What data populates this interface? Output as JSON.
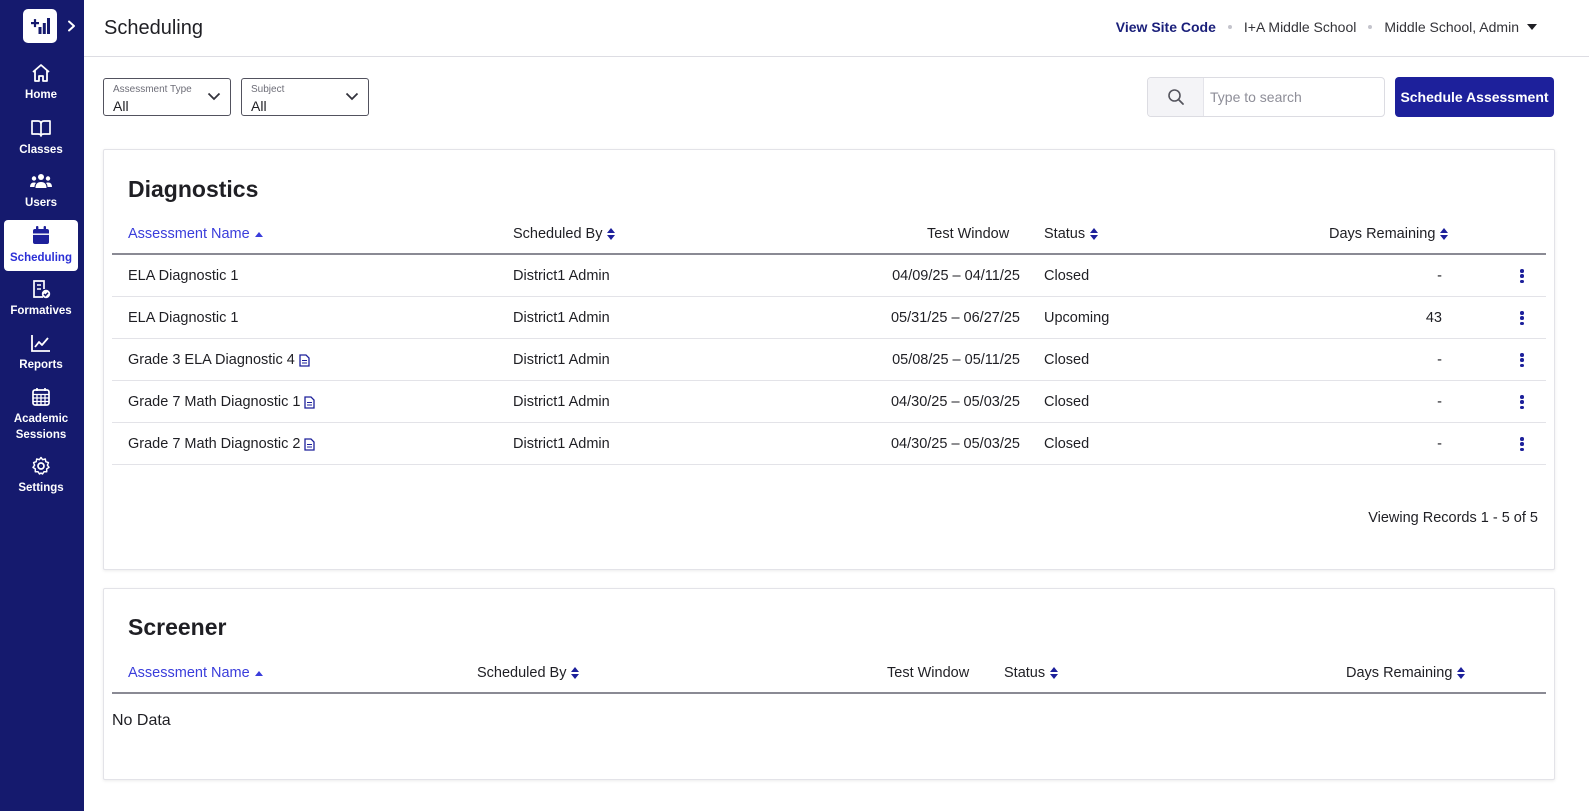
{
  "sidebar": {
    "items": [
      {
        "label": "Home",
        "icon": "home-icon"
      },
      {
        "label": "Classes",
        "icon": "book-icon"
      },
      {
        "label": "Users",
        "icon": "users-icon"
      },
      {
        "label": "Scheduling",
        "icon": "calendar-icon",
        "active": true
      },
      {
        "label": "Formatives",
        "icon": "formatives-icon"
      },
      {
        "label": "Reports",
        "icon": "chart-icon"
      },
      {
        "label": "Academic Sessions",
        "icon": "grid-calendar-icon"
      },
      {
        "label": "Settings",
        "icon": "gear-icon"
      }
    ]
  },
  "header": {
    "title": "Scheduling",
    "site_code_link": "View Site Code",
    "school": "I+A Middle School",
    "user": "Middle School, Admin"
  },
  "filters": {
    "assessment_type": {
      "label": "Assessment Type",
      "value": "All"
    },
    "subject": {
      "label": "Subject",
      "value": "All"
    }
  },
  "search": {
    "placeholder": "Type to search"
  },
  "actions": {
    "schedule_label": "Schedule Assessment"
  },
  "diagnostics": {
    "title": "Diagnostics",
    "columns": {
      "name": "Assessment Name",
      "scheduled_by": "Scheduled By",
      "test_window": "Test Window",
      "status": "Status",
      "days_remaining": "Days Remaining"
    },
    "rows": [
      {
        "name": "ELA Diagnostic 1",
        "doc": false,
        "scheduled_by": "District1 Admin",
        "window": "04/09/25 – 04/11/25",
        "status": "Closed",
        "days": "-"
      },
      {
        "name": "ELA Diagnostic 1",
        "doc": false,
        "scheduled_by": "District1 Admin",
        "window": "05/31/25 – 06/27/25",
        "status": "Upcoming",
        "days": "43"
      },
      {
        "name": "Grade 3 ELA Diagnostic 4",
        "doc": true,
        "scheduled_by": "District1 Admin",
        "window": "05/08/25 – 05/11/25",
        "status": "Closed",
        "days": "-"
      },
      {
        "name": "Grade 7 Math Diagnostic 1",
        "doc": true,
        "scheduled_by": "District1 Admin",
        "window": "04/30/25 – 05/03/25",
        "status": "Closed",
        "days": "-"
      },
      {
        "name": "Grade 7 Math Diagnostic 2",
        "doc": true,
        "scheduled_by": "District1 Admin",
        "window": "04/30/25 – 05/03/25",
        "status": "Closed",
        "days": "-"
      }
    ],
    "footer": "Viewing Records 1 - 5 of 5"
  },
  "screener": {
    "title": "Screener",
    "columns": {
      "name": "Assessment Name",
      "scheduled_by": "Scheduled By",
      "test_window": "Test Window",
      "status": "Status",
      "days_remaining": "Days Remaining"
    },
    "empty": "No Data"
  },
  "colors": {
    "sidebar_bg": "#151a6e",
    "accent": "#1d209b",
    "link": "#3a3ddb"
  }
}
